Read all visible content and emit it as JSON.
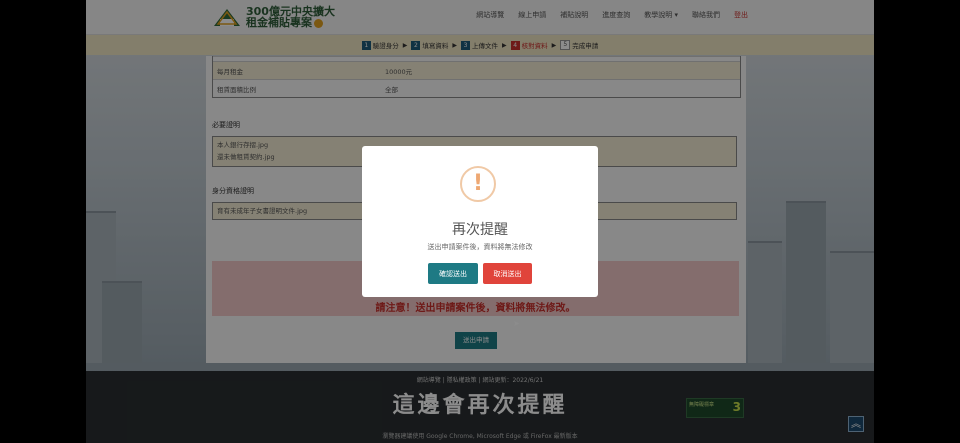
{
  "header": {
    "logo_line1": "300億元中央擴大",
    "logo_line2": "租金補貼專案",
    "nav": [
      "網站導覽",
      "線上申請",
      "補貼說明",
      "進度查詢",
      "教學說明 ▾",
      "聯絡我們",
      "登出"
    ]
  },
  "steps": [
    {
      "num": "1",
      "label": "驗證身分"
    },
    {
      "num": "2",
      "label": "填寫資料"
    },
    {
      "num": "3",
      "label": "上傳文件"
    },
    {
      "num": "4",
      "label": "核對資料"
    },
    {
      "num": "5",
      "label": "完成申請"
    }
  ],
  "table": {
    "rows": [
      {
        "key": "每月租金",
        "value": "10000元"
      },
      {
        "key": "租賃面積比例",
        "value": "全部"
      }
    ]
  },
  "sections": {
    "required_title": "必要證明",
    "required_files": [
      "本人銀行存摺.jpg",
      "還未做租賃契約.jpg"
    ],
    "identity_title": "身分資格證明",
    "identity_files": [
      "育有未成年子女書證明文件.jpg"
    ]
  },
  "warning": {
    "text": "請注意！送出申請案件後，資料將無法修改。"
  },
  "submit_label": "送出申請",
  "modal": {
    "icon": "!",
    "title": "再次提醒",
    "message": "送出申請案件後，資料將無法修改",
    "confirm_label": "確認送出",
    "cancel_label": "取消送出"
  },
  "footer": {
    "links": "網站導覽 | 隱私權政策 | 網站更新：2022/6/21",
    "caption": "這邊會再次提醒",
    "note": "瀏覽器建議使用 Google Chrome, Microsoft Edge 或 FireFox 最新版本",
    "badge_text": "無障礙標章",
    "badge_num": "3"
  },
  "colors": {
    "teal": "#1e7a84",
    "red": "#e0443b",
    "warning_bg": "#f0c6c6",
    "steps_bg": "#efe5c4"
  }
}
